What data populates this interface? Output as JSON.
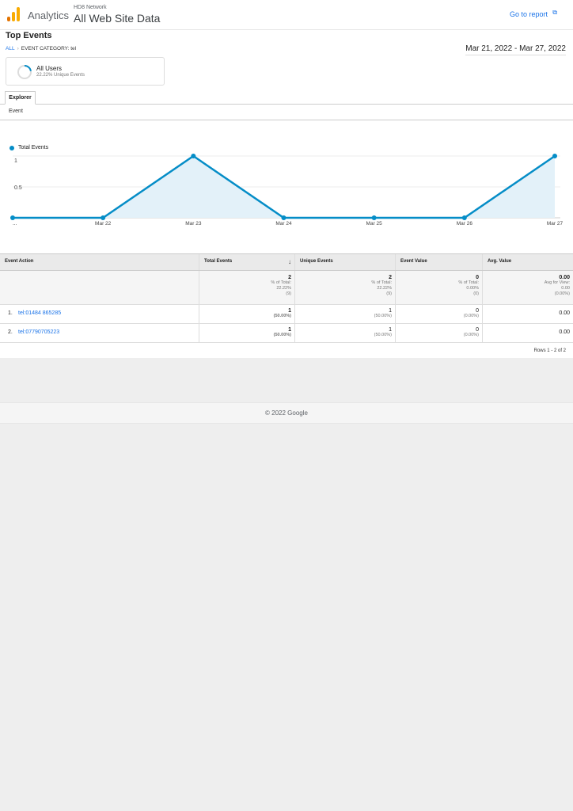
{
  "header": {
    "app_name": "Analytics",
    "account": "HD8 Network",
    "property": "All Web Site Data",
    "goto_report": "Go to report",
    "logo_colors": [
      "#f9ab00",
      "#e37400",
      "#f9ab00"
    ]
  },
  "page": {
    "title": "Top Events",
    "breadcrumb_all": "ALL",
    "breadcrumb_sep": "›",
    "breadcrumb_current": "EVENT CATEGORY: tel",
    "date_range": "Mar 21, 2022 - Mar 27, 2022"
  },
  "segment": {
    "name": "All Users",
    "sub": "22.22% Unique Events",
    "percent": 22.22
  },
  "tabs": {
    "explorer": "Explorer",
    "sub": "Event"
  },
  "chart_data": {
    "type": "area",
    "series": [
      {
        "name": "Total Events",
        "values": [
          0,
          0,
          1,
          0,
          0,
          0,
          1
        ]
      }
    ],
    "x": [
      "...",
      "Mar 22",
      "Mar 23",
      "Mar 24",
      "Mar 25",
      "Mar 26",
      "Mar 27"
    ],
    "y_ticks": [
      "1",
      "0.5"
    ],
    "ylim": [
      0,
      1
    ],
    "color": "#058dc7",
    "fill": "#e3f1f9",
    "grid": true,
    "legend": "top-left"
  },
  "table": {
    "headers": [
      "Event Action",
      "Total Events",
      "Unique Events",
      "Event Value",
      "Avg. Value"
    ],
    "totals": [
      {
        "value": "2",
        "label": "% of Total:",
        "pct": "22.22%",
        "abs": "(9)"
      },
      {
        "value": "2",
        "label": "% of Total:",
        "pct": "22.22%",
        "abs": "(9)"
      },
      {
        "value": "0",
        "label": "% of Total:",
        "pct": "0.00%",
        "abs": "(0)"
      },
      {
        "value": "0.00",
        "label": "Avg for View:",
        "pct": "0.00",
        "abs": "(0.00%)"
      }
    ],
    "rows": [
      {
        "num": "1.",
        "action": "tel:01484 865285",
        "total": "1",
        "total_pct": "(50.00%)",
        "unique": "1",
        "unique_pct": "(50.00%)",
        "value": "0",
        "value_pct": "(0.00%)",
        "avg": "0.00"
      },
      {
        "num": "2.",
        "action": "tel:07790705223",
        "total": "1",
        "total_pct": "(50.00%)",
        "unique": "1",
        "unique_pct": "(50.00%)",
        "value": "0",
        "value_pct": "(0.00%)",
        "avg": "0.00"
      }
    ],
    "rows_info": "Rows 1 - 2 of 2"
  },
  "footer": {
    "copyright": "© 2022 Google"
  }
}
